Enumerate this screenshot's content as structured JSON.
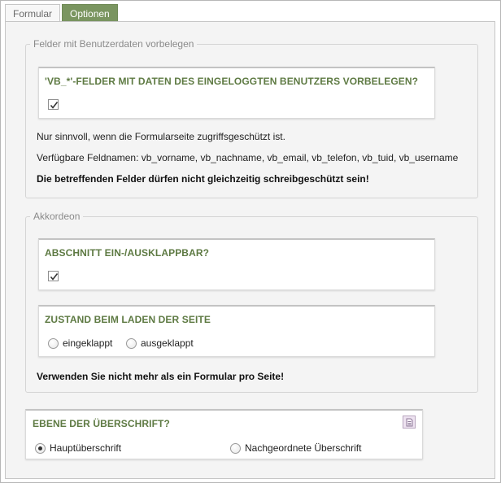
{
  "tabs": [
    {
      "label": "Formular",
      "active": false
    },
    {
      "label": "Optionen",
      "active": true
    }
  ],
  "userdata_group": {
    "legend": "Felder mit Benutzerdaten vorbelegen",
    "field_title": "'VB_*'-FELDER MIT DATEN DES EINGELOGGTEN BENUTZERS VORBELEGEN?",
    "checked": true,
    "note1": "Nur sinnvoll, wenn die Formularseite zugriffsgeschützt ist.",
    "note2": "Verfügbare Feldnamen: vb_vorname, vb_nachname, vb_email, vb_telefon, vb_tuid, vb_username",
    "warning": "Die betreffenden Felder dürfen nicht gleichzeitig schreibgeschützt sein!"
  },
  "accordion_group": {
    "legend": "Akkordeon",
    "collapsible_title": "ABSCHNITT EIN-/AUSKLAPPBAR?",
    "collapsible_checked": true,
    "state_title": "ZUSTAND BEIM LADEN DER SEITE",
    "state_options": [
      "eingeklappt",
      "ausgeklappt"
    ],
    "state_selected": null,
    "warning": "Verwenden Sie nicht mehr als ein Formular pro Seite!"
  },
  "heading_level": {
    "title": "EBENE DER ÜBERSCHRIFT?",
    "options": [
      "Hauptüberschrift",
      "Nachgeordnete Überschrift"
    ],
    "selected": "Hauptüberschrift",
    "icon": "document-icon"
  },
  "colors": {
    "active_tab": "#7a9560",
    "field_title": "#5e7a43"
  }
}
